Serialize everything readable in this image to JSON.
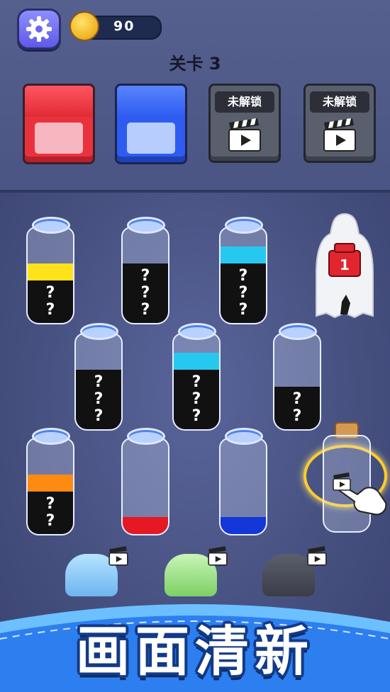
{
  "hud": {
    "coins": "90",
    "level_label": "关卡 3"
  },
  "slots": [
    {
      "state": "filled",
      "color": "#e9323e"
    },
    {
      "state": "filled",
      "color": "#2e5cf0"
    },
    {
      "state": "locked",
      "label": "未解锁"
    },
    {
      "state": "locked",
      "label": "未解锁"
    }
  ],
  "bottles": [
    {
      "layers": [
        {
          "color": "#111111",
          "fraction": 0.45,
          "label": "?\n?"
        },
        {
          "color": "#ffe31a",
          "fraction": 0.18,
          "label": ""
        }
      ]
    },
    {
      "layers": [
        {
          "color": "#111111",
          "fraction": 0.63,
          "label": "?\n?\n?"
        }
      ]
    },
    {
      "layers": [
        {
          "color": "#111111",
          "fraction": 0.63,
          "label": "?\n?\n?"
        },
        {
          "color": "#27c8f0",
          "fraction": 0.18,
          "label": ""
        }
      ]
    },
    {
      "layers": [
        {
          "color": "#111111",
          "fraction": 0.63,
          "label": "?\n?\n?"
        }
      ]
    },
    {
      "layers": [
        {
          "color": "#111111",
          "fraction": 0.63,
          "label": "?\n?\n?"
        },
        {
          "color": "#27c8f0",
          "fraction": 0.18,
          "label": ""
        }
      ]
    },
    {
      "layers": [
        {
          "color": "#111111",
          "fraction": 0.45,
          "label": "?\n?"
        }
      ]
    },
    {
      "layers": [
        {
          "color": "#111111",
          "fraction": 0.45,
          "label": "?\n?"
        },
        {
          "color": "#ff8a12",
          "fraction": 0.18,
          "label": ""
        }
      ]
    },
    {
      "layers": [
        {
          "color": "#e61824",
          "fraction": 0.18,
          "label": ""
        }
      ]
    },
    {
      "layers": [
        {
          "color": "#1337d8",
          "fraction": 0.18,
          "label": ""
        }
      ]
    }
  ],
  "locked_bottle": {
    "badge": "1"
  },
  "banner": {
    "text": "画面清新"
  }
}
